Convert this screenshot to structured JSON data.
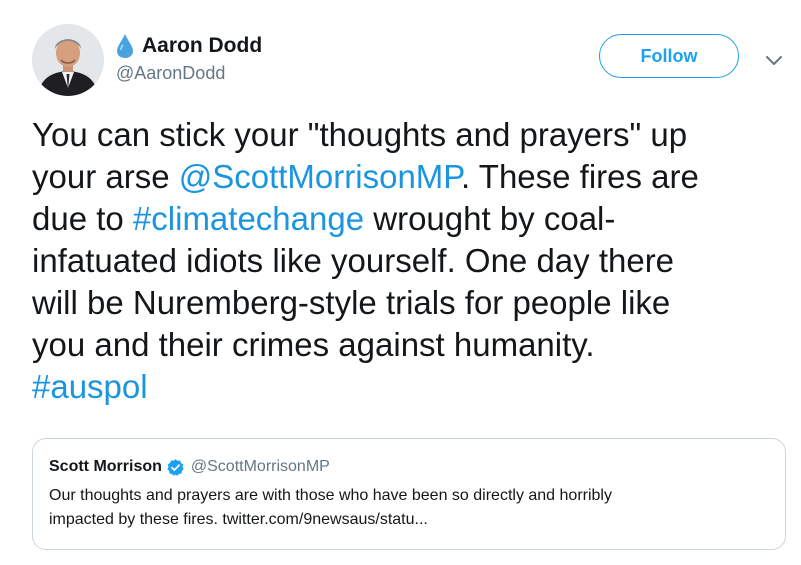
{
  "author": {
    "display_name": "Aaron Dodd",
    "handle": "@AaronDodd",
    "name_emoji": "water-drop-icon"
  },
  "follow_button": {
    "label": "Follow"
  },
  "more_menu": {
    "icon": "chevron-down-icon"
  },
  "tweet": {
    "lines": [
      [
        {
          "text": "You can stick your \"thoughts and prayers\" up",
          "type": "text"
        }
      ],
      [
        {
          "text": "your arse ",
          "type": "text"
        },
        {
          "text": "@ScottMorrisonMP",
          "type": "mention"
        },
        {
          "text": ". These fires are",
          "type": "text"
        }
      ],
      [
        {
          "text": "due to ",
          "type": "text"
        },
        {
          "text": "#climatechange",
          "type": "hashtag"
        },
        {
          "text": " wrought by coal-",
          "type": "text"
        }
      ],
      [
        {
          "text": "infatuated idiots like yourself. One day there",
          "type": "text"
        }
      ],
      [
        {
          "text": "will be Nuremberg-style trials for people like",
          "type": "text"
        }
      ],
      [
        {
          "text": "you and their crimes against humanity.",
          "type": "text"
        }
      ],
      [
        {
          "text": "#auspol",
          "type": "hashtag"
        }
      ]
    ]
  },
  "quoted_tweet": {
    "display_name": "Scott Morrison",
    "verified": true,
    "handle": "@ScottMorrisonMP",
    "lines": [
      "Our thoughts and prayers are with those who have been so directly and horribly",
      "impacted by these fires. twitter.com/9newsaus/statu..."
    ]
  },
  "colors": {
    "link": "#1b95e0",
    "follow": "#1da1f2",
    "muted": "#657786",
    "border": "#ccd6dd",
    "text": "#14171a"
  }
}
